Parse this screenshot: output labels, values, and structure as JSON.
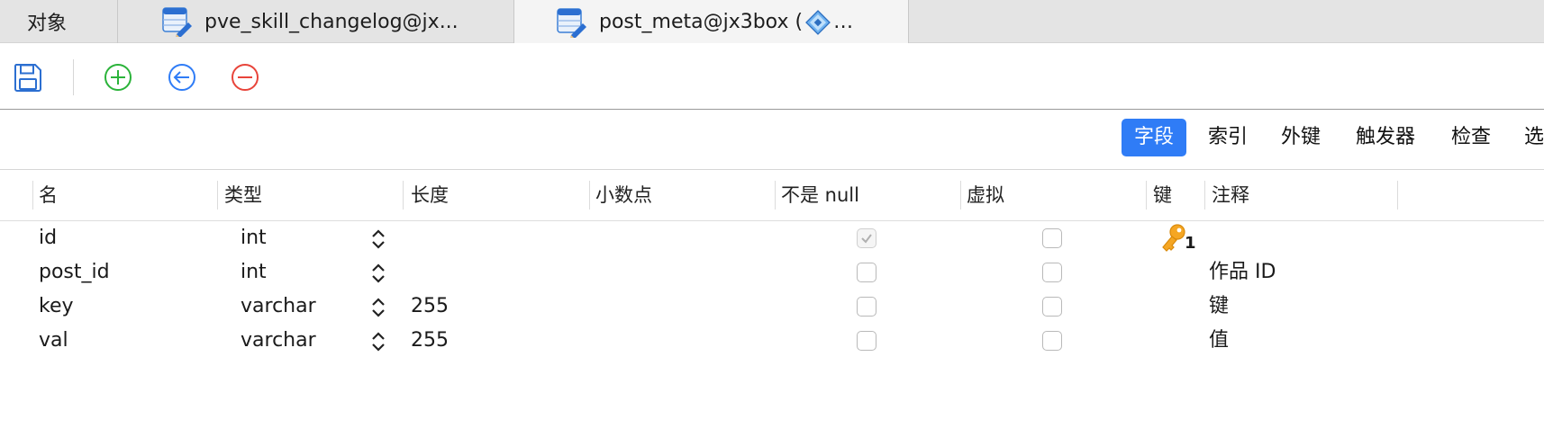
{
  "tabs": [
    {
      "label": "对象",
      "active": false
    },
    {
      "label": "pve_skill_changelog@jx...",
      "active": false
    },
    {
      "label": "post_meta@jx3box (",
      "suffix": "…",
      "active": true
    }
  ],
  "toolbar": {
    "save": "save-icon",
    "add": "add-field-icon",
    "insert": "insert-field-icon",
    "delete": "delete-field-icon"
  },
  "segments": [
    "字段",
    "索引",
    "外键",
    "触发器",
    "检查",
    "选"
  ],
  "columns": [
    "名",
    "类型",
    "长度",
    "小数点",
    "不是 null",
    "虚拟",
    "键",
    "注释"
  ],
  "rows": [
    {
      "name": "id",
      "type": "int",
      "length": "",
      "decimals": "",
      "not_null": true,
      "virtual": false,
      "key": "1",
      "comment": ""
    },
    {
      "name": "post_id",
      "type": "int",
      "length": "",
      "decimals": "",
      "not_null": false,
      "virtual": false,
      "key": "",
      "comment": "作品 ID"
    },
    {
      "name": "key",
      "type": "varchar",
      "length": "255",
      "decimals": "",
      "not_null": false,
      "virtual": false,
      "key": "",
      "comment": "键"
    },
    {
      "name": "val",
      "type": "varchar",
      "length": "255",
      "decimals": "",
      "not_null": false,
      "virtual": false,
      "key": "",
      "comment": "值"
    }
  ],
  "colors": {
    "accent": "#2f7cf6",
    "add": "#2bb33a",
    "insert": "#2f7cf6",
    "delete": "#e8443a",
    "key": "#f5a623"
  }
}
